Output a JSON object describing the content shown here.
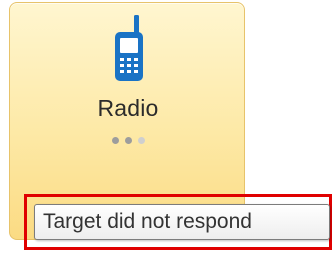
{
  "tile": {
    "label": "Radio",
    "icon": "mobile-radio-icon",
    "page_indicator": {
      "total": 3,
      "active_states": [
        true,
        true,
        false
      ]
    },
    "colors": {
      "icon": "#1a73c5",
      "border": "#e7c36a",
      "gradient_top": "#fff6d0",
      "gradient_bottom": "#fbdb83"
    }
  },
  "tooltip": {
    "text": "Target did not respond",
    "highlight_color": "#e00000"
  }
}
